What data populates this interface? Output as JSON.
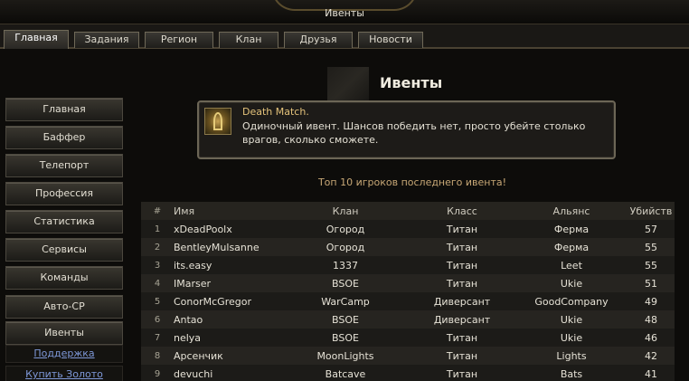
{
  "window": {
    "title": "Ивенты"
  },
  "tabs": [
    {
      "label": "Главная",
      "active": true
    },
    {
      "label": "Задания"
    },
    {
      "label": "Регион"
    },
    {
      "label": "Клан"
    },
    {
      "label": "Друзья"
    },
    {
      "label": "Новости"
    }
  ],
  "sidebar": {
    "buttons": [
      "Главная",
      "Баффер",
      "Телепорт",
      "Профессия",
      "Статистика",
      "Сервисы",
      "Команды",
      "Авто-СР",
      "Ивенты"
    ],
    "links": [
      "Поддержка",
      "Купить Золото"
    ]
  },
  "page": {
    "heading": "Ивенты"
  },
  "event": {
    "title": "Death Match.",
    "description": "Одиночный ивент. Шансов победить нет, просто убейте столько врагов, сколько сможете.",
    "icon": "event-emblem-icon"
  },
  "leaderboard": {
    "caption": "Топ 10 игроков последнего ивента!",
    "headers": {
      "num": "#",
      "name": "Имя",
      "clan": "Клан",
      "class": "Класс",
      "alliance": "Альянс",
      "kills": "Убийств"
    },
    "rows": [
      {
        "num": "1",
        "name": "xDeadPoolx",
        "clan": "Огород",
        "class": "Титан",
        "alliance": "Ферма",
        "kills": "57"
      },
      {
        "num": "2",
        "name": "BentleyMulsanne",
        "clan": "Огород",
        "class": "Титан",
        "alliance": "Ферма",
        "kills": "55"
      },
      {
        "num": "3",
        "name": "its.easy",
        "clan": "1337",
        "class": "Титан",
        "alliance": "Leet",
        "kills": "55"
      },
      {
        "num": "4",
        "name": "IMarser",
        "clan": "BSOE",
        "class": "Титан",
        "alliance": "Ukie",
        "kills": "51"
      },
      {
        "num": "5",
        "name": "ConorMcGregor",
        "clan": "WarCamp",
        "class": "Диверсант",
        "alliance": "GoodCompany",
        "kills": "49"
      },
      {
        "num": "6",
        "name": "Antao",
        "clan": "BSOE",
        "class": "Диверсант",
        "alliance": "Ukie",
        "kills": "48"
      },
      {
        "num": "7",
        "name": "nelya",
        "clan": "BSOE",
        "class": "Титан",
        "alliance": "Ukie",
        "kills": "46"
      },
      {
        "num": "8",
        "name": "Арсенчик",
        "clan": "MoonLights",
        "class": "Титан",
        "alliance": "Lights",
        "kills": "42"
      },
      {
        "num": "9",
        "name": "devuchi",
        "clan": "Batcave",
        "class": "Титан",
        "alliance": "Bats",
        "kills": "41"
      }
    ]
  },
  "colors": {
    "accent": "#c8a876",
    "link": "#7e98d8",
    "eventTitle": "#e3c27a"
  }
}
